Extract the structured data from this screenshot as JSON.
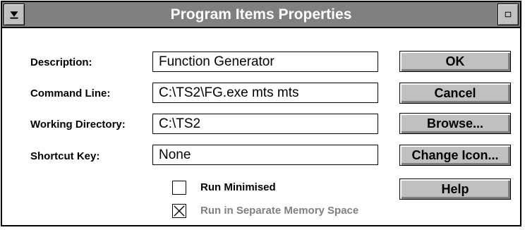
{
  "window": {
    "title": "Program Items Properties",
    "sysmenu_icon": "window-menu-icon",
    "restore_icon": "restore-icon"
  },
  "fields": {
    "description": {
      "label": "Description:",
      "value": "Function Generator"
    },
    "command_line": {
      "label": "Command Line:",
      "value": "C:\\TS2\\FG.exe mts mts"
    },
    "working_directory": {
      "label": "Working Directory:",
      "value": "C:\\TS2"
    },
    "shortcut_key": {
      "label": "Shortcut Key:",
      "value": "None"
    }
  },
  "checkboxes": {
    "run_minimised": {
      "label": "Run Minimised",
      "checked": false,
      "enabled": true
    },
    "run_separate_memory": {
      "label": "Run in Separate Memory Space",
      "checked": true,
      "enabled": false
    }
  },
  "buttons": {
    "ok": "OK",
    "cancel": "Cancel",
    "browse": "Browse...",
    "change_icon": "Change Icon...",
    "help": "Help"
  },
  "colors": {
    "titlebar": "#808080",
    "button_face": "#c0c0c0",
    "disabled_text": "#808080"
  }
}
